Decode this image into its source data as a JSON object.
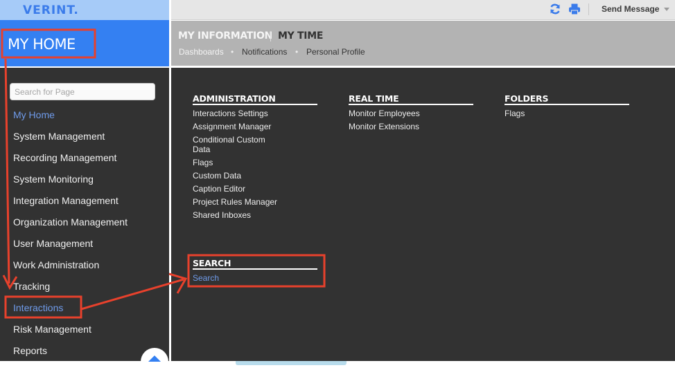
{
  "brand": {
    "logo": "VERINT."
  },
  "home": {
    "title": "MY HOME"
  },
  "sidebar": {
    "search_placeholder": "Search for Page",
    "items": [
      {
        "label": "My Home",
        "active": true
      },
      {
        "label": "System Management"
      },
      {
        "label": "Recording Management"
      },
      {
        "label": "System Monitoring"
      },
      {
        "label": "Integration Management"
      },
      {
        "label": "Organization Management"
      },
      {
        "label": "User Management"
      },
      {
        "label": "Work Administration"
      },
      {
        "label": "Tracking"
      },
      {
        "label": "Interactions",
        "active": true
      },
      {
        "label": "Risk Management"
      },
      {
        "label": "Reports"
      }
    ]
  },
  "toolbar": {
    "refresh_icon": "refresh-icon",
    "print_icon": "print-icon",
    "send_message": "Send Message"
  },
  "header": {
    "tabs": [
      {
        "label": "MY INFORMATION",
        "active": false
      },
      {
        "label": "MY TIME",
        "active": true
      }
    ],
    "sublinks": [
      {
        "label": "Dashboards",
        "active": true
      },
      {
        "label": "Notifications"
      },
      {
        "label": "Personal Profile"
      }
    ],
    "separator": "•"
  },
  "sections": {
    "administration": {
      "title": "ADMINISTRATION",
      "links": [
        "Interactions Settings",
        "Assignment Manager",
        "Conditional Custom",
        "Data",
        "Flags",
        "Custom Data",
        "Caption Editor",
        "Project Rules Manager",
        "Shared Inboxes"
      ]
    },
    "realtime": {
      "title": "REAL TIME",
      "links": [
        "Monitor Employees",
        "Monitor Extensions"
      ]
    },
    "folders": {
      "title": "FOLDERS",
      "links": [
        "Flags"
      ]
    },
    "search": {
      "title": "SEARCH",
      "links": [
        "Search"
      ]
    }
  },
  "colors": {
    "accent_blue": "#3480f2",
    "link_blue": "#6f9bea",
    "annotation_red": "#e8412c",
    "sidebar_bg": "#323232"
  }
}
